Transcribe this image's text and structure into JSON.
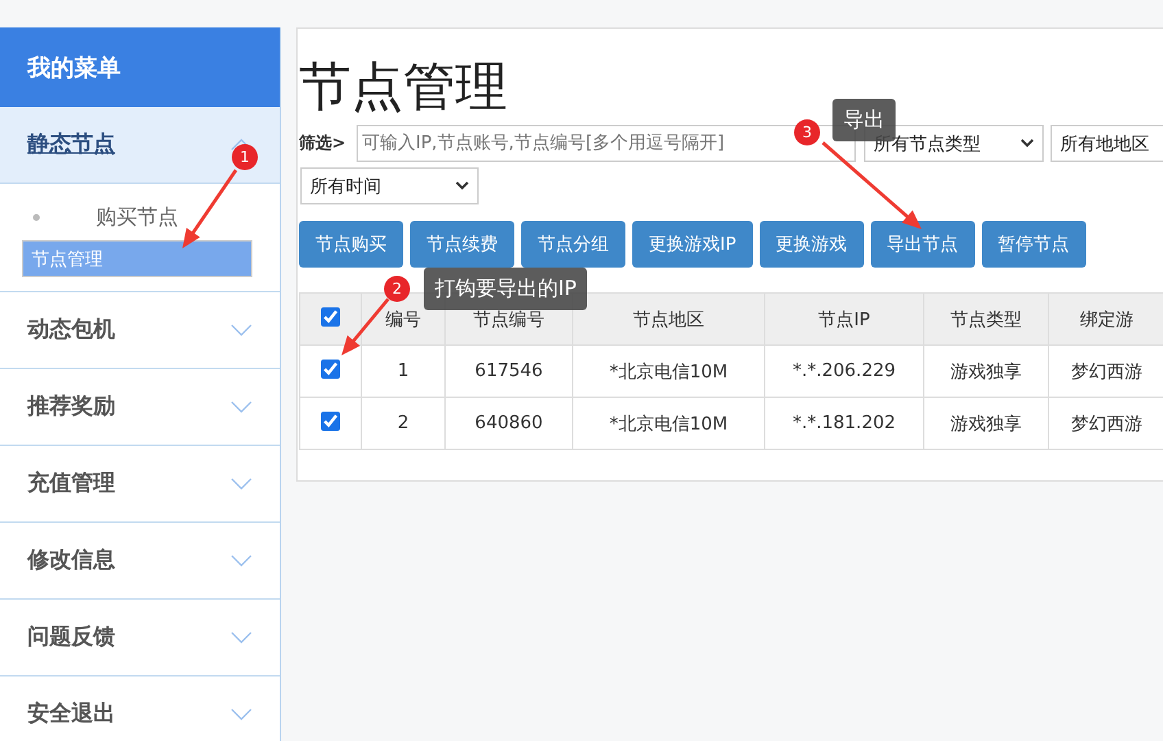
{
  "sidebar": {
    "title": "我的菜单",
    "items": [
      {
        "label": "静态节点",
        "expanded": true,
        "children": [
          {
            "label": "购买节点",
            "selected": false
          },
          {
            "label": "节点管理",
            "selected": true
          }
        ]
      },
      {
        "label": "动态包机",
        "expanded": false
      },
      {
        "label": "推荐奖励",
        "expanded": false
      },
      {
        "label": "充值管理",
        "expanded": false
      },
      {
        "label": "修改信息",
        "expanded": false
      },
      {
        "label": "问题反馈",
        "expanded": false
      },
      {
        "label": "安全退出",
        "expanded": false
      }
    ]
  },
  "page_title": "节点管理",
  "filter": {
    "label": "筛选>",
    "placeholder": "可输入IP,节点账号,节点编号[多个用逗号隔开]",
    "selects": [
      "所有节点类型",
      "所有地地区",
      "所有时间"
    ]
  },
  "buttons": [
    "节点购买",
    "节点续费",
    "节点分组",
    "更换游戏IP",
    "更换游戏",
    "导出节点",
    "暂停节点"
  ],
  "table": {
    "all_checked": true,
    "columns": [
      "编号",
      "节点编号",
      "节点地区",
      "节点IP",
      "节点类型",
      "绑定游"
    ],
    "rows": [
      {
        "checked": true,
        "cells": [
          "1",
          "617546",
          "*北京电信10M",
          "*.*.206.229",
          "游戏独享",
          "梦幻西游"
        ]
      },
      {
        "checked": true,
        "cells": [
          "2",
          "640860",
          "*北京电信10M",
          "*.*.181.202",
          "游戏独享",
          "梦幻西游"
        ]
      }
    ]
  },
  "annotations": [
    {
      "number": "1"
    },
    {
      "number": "2",
      "note": "打钩要导出的IP"
    },
    {
      "number": "3",
      "note": "导出"
    }
  ]
}
